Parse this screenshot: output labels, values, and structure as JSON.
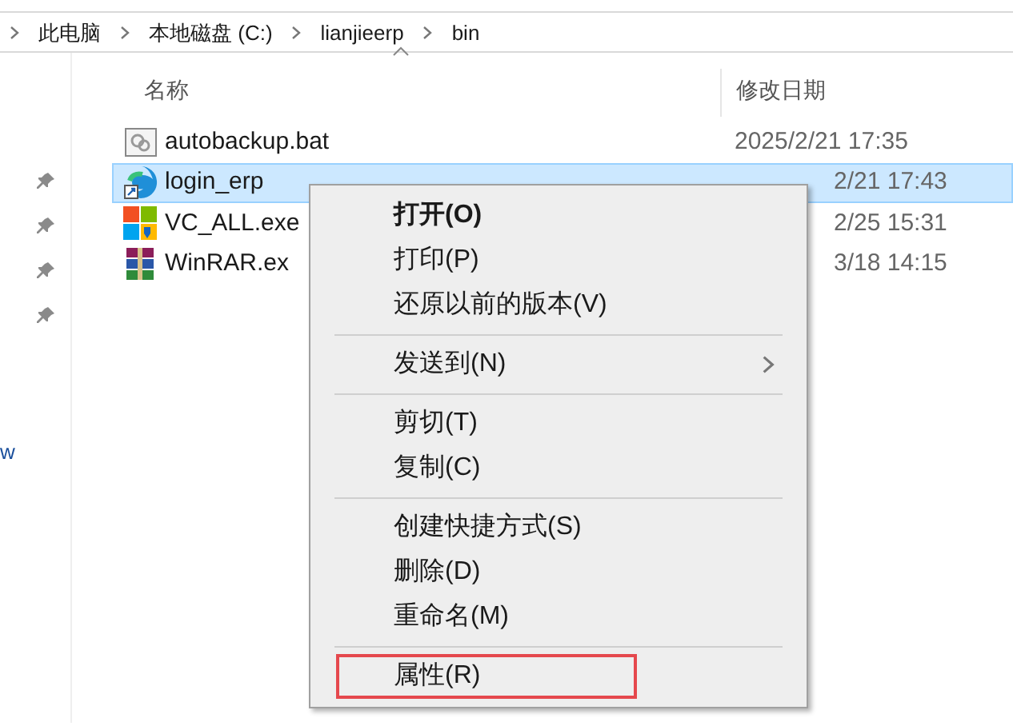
{
  "breadcrumb": [
    "此电脑",
    "本地磁盘 (C:)",
    "lianjieerp",
    "bin"
  ],
  "sidebar": {
    "text": "w"
  },
  "columns": [
    "名称",
    "修改日期"
  ],
  "files": [
    {
      "kind": "bat",
      "name": "autobackup.bat",
      "date": "2025/2/21 17:35",
      "selected": false
    },
    {
      "kind": "edge",
      "name": "login_erp",
      "date": "2/21 17:43",
      "selected": true
    },
    {
      "kind": "installer",
      "name": "VC_ALL.exe",
      "date": "2/25 15:31",
      "selected": false
    },
    {
      "kind": "archive",
      "name": "WinRAR.ex",
      "date": "3/18 14:15",
      "selected": false
    }
  ],
  "context_menu": [
    {
      "kind": "item",
      "label": "打开(O)",
      "bold": true
    },
    {
      "kind": "item",
      "label": "打印(P)"
    },
    {
      "kind": "item",
      "label": "还原以前的版本(V)"
    },
    {
      "kind": "separator"
    },
    {
      "kind": "submenu",
      "label": "发送到(N)"
    },
    {
      "kind": "separator"
    },
    {
      "kind": "item",
      "label": "剪切(T)"
    },
    {
      "kind": "item",
      "label": "复制(C)"
    },
    {
      "kind": "separator"
    },
    {
      "kind": "item",
      "label": "创建快捷方式(S)"
    },
    {
      "kind": "item",
      "label": "删除(D)"
    },
    {
      "kind": "item",
      "label": "重命名(M)"
    },
    {
      "kind": "separator"
    },
    {
      "kind": "item",
      "label": "属性(R)",
      "highlighted": true
    }
  ]
}
